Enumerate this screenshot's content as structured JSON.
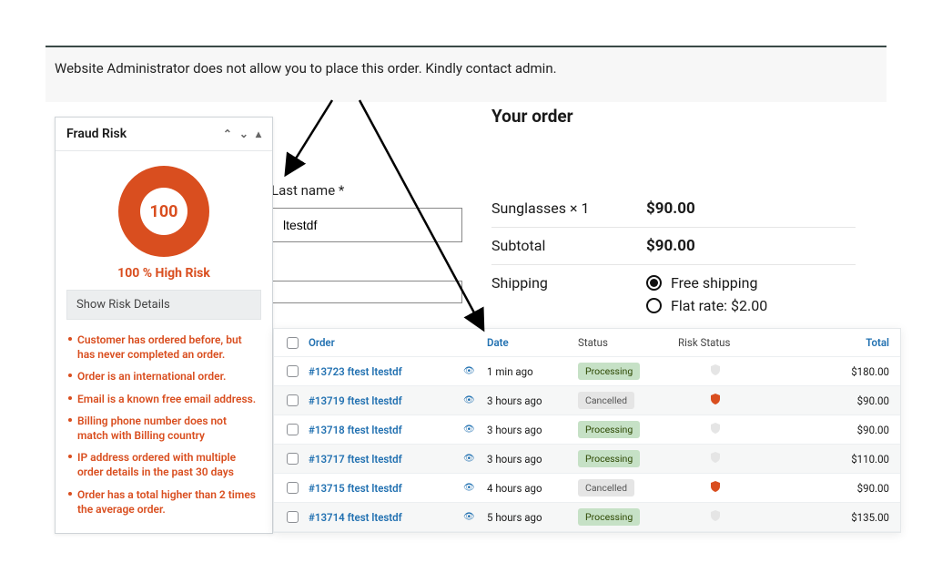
{
  "notice": "Website Administrator does not allow you to place this order. Kindly contact admin.",
  "fraud": {
    "title": "Fraud Risk",
    "score": "100",
    "label": "100 % High Risk",
    "show_details": "Show Risk Details",
    "reasons": [
      "Customer has ordered before, but has never completed an order.",
      "Order is an international order.",
      "Email is a known free email address.",
      "Billing phone number does not match with Billing country",
      "IP address ordered with multiple order details in the past 30 days",
      "Order has a total higher than 2 times the average order."
    ]
  },
  "checkout": {
    "last_name_label": "Last name *",
    "last_name_value": "ltestdf"
  },
  "order_summary": {
    "title": "Your order",
    "line_item": "Sunglasses  × 1",
    "line_total": "$90.00",
    "subtotal_label": "Subtotal",
    "subtotal_value": "$90.00",
    "shipping_label": "Shipping",
    "shipping_options": [
      {
        "label": "Free shipping",
        "selected": true
      },
      {
        "label": "Flat rate: $2.00",
        "selected": false
      }
    ]
  },
  "orders": {
    "columns": {
      "order": "Order",
      "date": "Date",
      "status": "Status",
      "risk": "Risk Status",
      "total": "Total"
    },
    "rows": [
      {
        "order": "#13723 ftest ltestdf",
        "date": "1 min ago",
        "status": "Processing",
        "status_type": "processing",
        "risk": "none",
        "total": "$180.00"
      },
      {
        "order": "#13719 ftest ltestdf",
        "date": "3 hours ago",
        "status": "Cancelled",
        "status_type": "cancelled",
        "risk": "red",
        "total": "$90.00"
      },
      {
        "order": "#13718 ftest ltestdf",
        "date": "3 hours ago",
        "status": "Processing",
        "status_type": "processing",
        "risk": "none",
        "total": "$90.00"
      },
      {
        "order": "#13717 ftest ltestdf",
        "date": "3 hours ago",
        "status": "Processing",
        "status_type": "processing",
        "risk": "none",
        "total": "$110.00"
      },
      {
        "order": "#13715 ftest ltestdf",
        "date": "4 hours ago",
        "status": "Cancelled",
        "status_type": "cancelled",
        "risk": "red",
        "total": "$90.00"
      },
      {
        "order": "#13714 ftest ltestdf",
        "date": "5 hours ago",
        "status": "Processing",
        "status_type": "processing",
        "risk": "none",
        "total": "$135.00"
      }
    ]
  },
  "chart_data": {
    "type": "pie",
    "title": "Fraud Risk",
    "values": [
      100
    ],
    "categories": [
      "High Risk"
    ],
    "colors": [
      "#d94e1f"
    ],
    "center_label": "100"
  }
}
